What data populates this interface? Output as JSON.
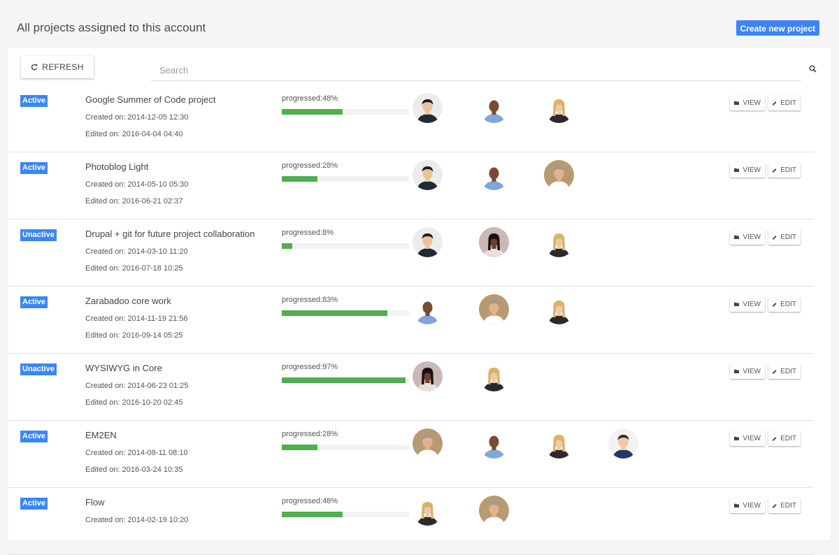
{
  "header": {
    "title": "All projects assigned to this account",
    "create_label": "Create new project"
  },
  "toolbar": {
    "refresh_label": "REFRESH",
    "search_placeholder": "Search"
  },
  "actions": {
    "view_label": "VIEW",
    "edit_label": "EDIT"
  },
  "projects": [
    {
      "status": "Active",
      "name": "Google Summer of Code project",
      "created": "Created on: 2014-12-05 12:30",
      "edited": "Edited on: 2016-04-04 04:40",
      "progress_label": "progressed:48%",
      "progress": 48,
      "members": [
        "asian-man",
        "bald-man",
        "blonde-woman"
      ]
    },
    {
      "status": "Active",
      "name": "Photoblog Light",
      "created": "Created on: 2014-05-10 05:30",
      "edited": "Edited on: 2016-06-21 02:37",
      "progress_label": "progressed:28%",
      "progress": 28,
      "members": [
        "asian-man",
        "bald-man",
        "gray-hair-man"
      ]
    },
    {
      "status": "Unactive",
      "name": "Drupal + git for future project collaboration",
      "created": "Created on: 2014-03-10 11:20",
      "edited": "Edited on: 2016-07-18 10:25",
      "progress_label": "progressed:8%",
      "progress": 8,
      "members": [
        "asian-man",
        "dark-hair-woman",
        "blonde-woman"
      ]
    },
    {
      "status": "Active",
      "name": "Zarabadoo core work",
      "created": "Created on: 2014-11-19 21:56",
      "edited": "Edited on: 2016-09-14 05:25",
      "progress_label": "progressed:83%",
      "progress": 83,
      "members": [
        "bald-man",
        "gray-hair-man",
        "blonde-woman"
      ]
    },
    {
      "status": "Unactive",
      "name": "WYSIWYG in Core",
      "created": "Created on: 2014-06-23 01:25",
      "edited": "Edited on: 2016-10-20 02:45",
      "progress_label": "progressed:97%",
      "progress": 97,
      "members": [
        "dark-hair-woman",
        "blonde-woman"
      ]
    },
    {
      "status": "Active",
      "name": "EM2EN",
      "created": "Created on: 2014-08-11 08:10",
      "edited": "Edited on: 2016-03-24 10:35",
      "progress_label": "progressed:28%",
      "progress": 28,
      "members": [
        "gray-hair-man",
        "bald-man",
        "blonde-woman",
        "young-man"
      ]
    },
    {
      "status": "Active",
      "name": "Flow",
      "created": "Created on: 2014-02-19 10:20",
      "edited": "",
      "progress_label": "progressed:48%",
      "progress": 48,
      "members": [
        "blonde-woman",
        "gray-hair-man"
      ]
    }
  ],
  "colors": {
    "accent": "#3b86f7",
    "progress": "#4caf50"
  }
}
